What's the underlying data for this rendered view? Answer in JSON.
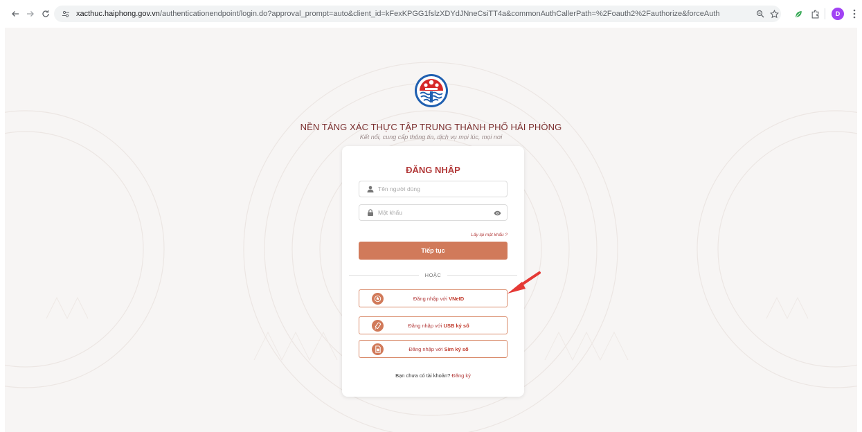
{
  "browser": {
    "url_host": "xacthuc.haiphong.gov.vn",
    "url_path": "/authenticationendpoint/login.do?approval_prompt=auto&client_id=kFexKPGG1fslzXDYdJNneCsiTT4a&commonAuthCallerPath=%2Foauth2%2Fauthorize&forceAuth=false&passiveAuth=false&redirect_uri=https%3A%...",
    "profile_initial": "D",
    "icons": [
      "back-icon",
      "forward-icon",
      "reload-icon",
      "site-settings-icon",
      "zoom-icon",
      "bookmark-star-icon",
      "extension-icon",
      "puzzle-icon",
      "profile-icon",
      "menu-icon"
    ]
  },
  "header": {
    "title": "NỀN TẢNG XÁC THỰC TẬP TRUNG THÀNH PHỐ HẢI PHÒNG",
    "subtitle": "Kết nối, cung cấp thông tin, dịch vụ mọi lúc, mọi nơi"
  },
  "login": {
    "title": "ĐĂNG NHẬP",
    "username_placeholder": "Tên người dùng",
    "password_placeholder": "Mật khẩu",
    "forgot_password": "Lấy lại mật khẩu ?",
    "submit_label": "Tiếp tục",
    "or_label": "HOẶC",
    "alt_prefix": "Đăng nhập với",
    "alt_methods": [
      {
        "label": "VNeID",
        "icon": "vneid-icon"
      },
      {
        "label": "USB ký số",
        "icon": "usb-token-icon"
      },
      {
        "label": "Sim ký số",
        "icon": "sim-card-icon"
      }
    ],
    "register_prompt": "Bạn chưa có tài khoản?",
    "register_link": "Đăng ký"
  },
  "colors": {
    "accent": "#d17a5a",
    "title_red": "#b23a3a",
    "page_bg": "#f7f5f4",
    "annotation_arrow": "#e53935"
  }
}
